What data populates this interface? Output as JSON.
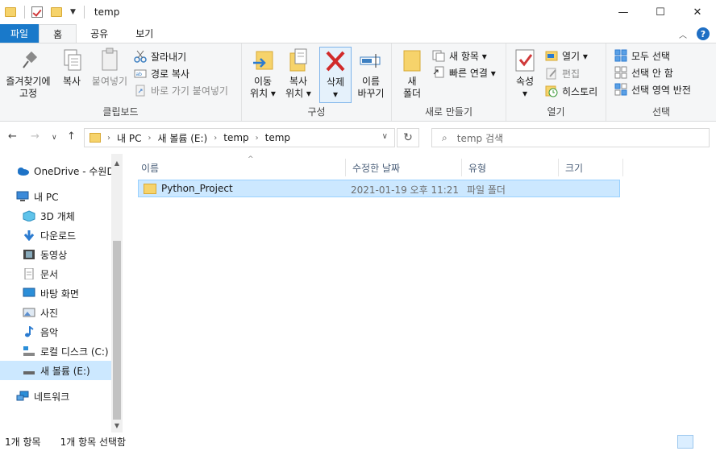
{
  "window": {
    "title": "temp",
    "minimize": "—",
    "maximize": "☐",
    "close": "✕"
  },
  "ribbon_tabs": [
    "파일",
    "홈",
    "공유",
    "보기"
  ],
  "ribbon": {
    "clipboard": {
      "label": "클립보드",
      "pin": [
        "즐겨찾기에",
        "고정"
      ],
      "copy": "복사",
      "paste": "붙여넣기",
      "cut": "잘라내기",
      "copy_path": "경로 복사",
      "paste_shortcut": "바로 가기 붙여넣기"
    },
    "organize": {
      "label": "구성",
      "move_to": [
        "이동",
        "위치 ▾"
      ],
      "copy_to": [
        "복사",
        "위치 ▾"
      ],
      "delete": "삭제",
      "rename": [
        "이름",
        "바꾸기"
      ]
    },
    "new": {
      "label": "새로 만들기",
      "new_folder": [
        "새",
        "폴더"
      ],
      "new_item": "새 항목 ▾",
      "easy_access": "빠른 연결 ▾"
    },
    "open": {
      "label": "열기",
      "properties": "속성",
      "open": "열기 ▾",
      "edit": "편집",
      "history": "히스토리"
    },
    "select": {
      "label": "선택",
      "select_all": "모두 선택",
      "select_none": "선택 안 함",
      "invert": "선택 영역 반전"
    }
  },
  "address": {
    "crumbs": [
      "내 PC",
      "새 볼륨 (E:)",
      "temp",
      "temp"
    ],
    "search_placeholder": "temp 검색"
  },
  "nav_pane": {
    "items": [
      {
        "label": "OneDrive - 수원D",
        "icon": "cloud-icon"
      },
      {
        "label": "내 PC",
        "icon": "pc-icon"
      },
      {
        "label": "3D 개체",
        "icon": "cube-icon"
      },
      {
        "label": "다운로드",
        "icon": "download-icon"
      },
      {
        "label": "동영상",
        "icon": "video-icon"
      },
      {
        "label": "문서",
        "icon": "document-icon"
      },
      {
        "label": "바탕 화면",
        "icon": "desktop-icon"
      },
      {
        "label": "사진",
        "icon": "picture-icon"
      },
      {
        "label": "음악",
        "icon": "music-icon"
      },
      {
        "label": "로컬 디스크 (C:)",
        "icon": "drive-icon"
      },
      {
        "label": "새 볼륨 (E:)",
        "icon": "drive-icon"
      },
      {
        "label": "네트워크",
        "icon": "network-icon"
      }
    ]
  },
  "file_list": {
    "columns": [
      "이름",
      "수정한 날짜",
      "유형",
      "크기"
    ],
    "rows": [
      {
        "name": "Python_Project",
        "modified": "2021-01-19 오후 11:21",
        "type": "파일 폴더",
        "size": ""
      }
    ]
  },
  "status": {
    "count": "1개 항목",
    "selected": "1개 항목 선택함"
  },
  "colors": {
    "accent": "#1979ca",
    "selection": "#cce8ff",
    "folder": "#f6d36b"
  }
}
